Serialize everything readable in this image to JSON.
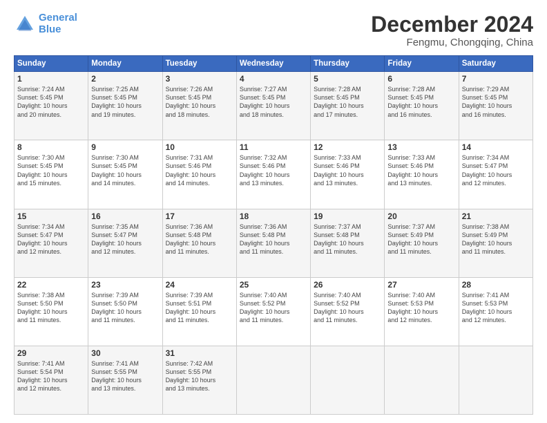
{
  "logo": {
    "line1": "General",
    "line2": "Blue"
  },
  "header": {
    "month": "December 2024",
    "location": "Fengmu, Chongqing, China"
  },
  "days_of_week": [
    "Sunday",
    "Monday",
    "Tuesday",
    "Wednesday",
    "Thursday",
    "Friday",
    "Saturday"
  ],
  "weeks": [
    [
      {
        "day": "1",
        "content": "Sunrise: 7:24 AM\nSunset: 5:45 PM\nDaylight: 10 hours\nand 20 minutes."
      },
      {
        "day": "2",
        "content": "Sunrise: 7:25 AM\nSunset: 5:45 PM\nDaylight: 10 hours\nand 19 minutes."
      },
      {
        "day": "3",
        "content": "Sunrise: 7:26 AM\nSunset: 5:45 PM\nDaylight: 10 hours\nand 18 minutes."
      },
      {
        "day": "4",
        "content": "Sunrise: 7:27 AM\nSunset: 5:45 PM\nDaylight: 10 hours\nand 18 minutes."
      },
      {
        "day": "5",
        "content": "Sunrise: 7:28 AM\nSunset: 5:45 PM\nDaylight: 10 hours\nand 17 minutes."
      },
      {
        "day": "6",
        "content": "Sunrise: 7:28 AM\nSunset: 5:45 PM\nDaylight: 10 hours\nand 16 minutes."
      },
      {
        "day": "7",
        "content": "Sunrise: 7:29 AM\nSunset: 5:45 PM\nDaylight: 10 hours\nand 16 minutes."
      }
    ],
    [
      {
        "day": "8",
        "content": "Sunrise: 7:30 AM\nSunset: 5:45 PM\nDaylight: 10 hours\nand 15 minutes."
      },
      {
        "day": "9",
        "content": "Sunrise: 7:30 AM\nSunset: 5:45 PM\nDaylight: 10 hours\nand 14 minutes."
      },
      {
        "day": "10",
        "content": "Sunrise: 7:31 AM\nSunset: 5:46 PM\nDaylight: 10 hours\nand 14 minutes."
      },
      {
        "day": "11",
        "content": "Sunrise: 7:32 AM\nSunset: 5:46 PM\nDaylight: 10 hours\nand 13 minutes."
      },
      {
        "day": "12",
        "content": "Sunrise: 7:33 AM\nSunset: 5:46 PM\nDaylight: 10 hours\nand 13 minutes."
      },
      {
        "day": "13",
        "content": "Sunrise: 7:33 AM\nSunset: 5:46 PM\nDaylight: 10 hours\nand 13 minutes."
      },
      {
        "day": "14",
        "content": "Sunrise: 7:34 AM\nSunset: 5:47 PM\nDaylight: 10 hours\nand 12 minutes."
      }
    ],
    [
      {
        "day": "15",
        "content": "Sunrise: 7:34 AM\nSunset: 5:47 PM\nDaylight: 10 hours\nand 12 minutes."
      },
      {
        "day": "16",
        "content": "Sunrise: 7:35 AM\nSunset: 5:47 PM\nDaylight: 10 hours\nand 12 minutes."
      },
      {
        "day": "17",
        "content": "Sunrise: 7:36 AM\nSunset: 5:48 PM\nDaylight: 10 hours\nand 11 minutes."
      },
      {
        "day": "18",
        "content": "Sunrise: 7:36 AM\nSunset: 5:48 PM\nDaylight: 10 hours\nand 11 minutes."
      },
      {
        "day": "19",
        "content": "Sunrise: 7:37 AM\nSunset: 5:48 PM\nDaylight: 10 hours\nand 11 minutes."
      },
      {
        "day": "20",
        "content": "Sunrise: 7:37 AM\nSunset: 5:49 PM\nDaylight: 10 hours\nand 11 minutes."
      },
      {
        "day": "21",
        "content": "Sunrise: 7:38 AM\nSunset: 5:49 PM\nDaylight: 10 hours\nand 11 minutes."
      }
    ],
    [
      {
        "day": "22",
        "content": "Sunrise: 7:38 AM\nSunset: 5:50 PM\nDaylight: 10 hours\nand 11 minutes."
      },
      {
        "day": "23",
        "content": "Sunrise: 7:39 AM\nSunset: 5:50 PM\nDaylight: 10 hours\nand 11 minutes."
      },
      {
        "day": "24",
        "content": "Sunrise: 7:39 AM\nSunset: 5:51 PM\nDaylight: 10 hours\nand 11 minutes."
      },
      {
        "day": "25",
        "content": "Sunrise: 7:40 AM\nSunset: 5:52 PM\nDaylight: 10 hours\nand 11 minutes."
      },
      {
        "day": "26",
        "content": "Sunrise: 7:40 AM\nSunset: 5:52 PM\nDaylight: 10 hours\nand 11 minutes."
      },
      {
        "day": "27",
        "content": "Sunrise: 7:40 AM\nSunset: 5:53 PM\nDaylight: 10 hours\nand 12 minutes."
      },
      {
        "day": "28",
        "content": "Sunrise: 7:41 AM\nSunset: 5:53 PM\nDaylight: 10 hours\nand 12 minutes."
      }
    ],
    [
      {
        "day": "29",
        "content": "Sunrise: 7:41 AM\nSunset: 5:54 PM\nDaylight: 10 hours\nand 12 minutes."
      },
      {
        "day": "30",
        "content": "Sunrise: 7:41 AM\nSunset: 5:55 PM\nDaylight: 10 hours\nand 13 minutes."
      },
      {
        "day": "31",
        "content": "Sunrise: 7:42 AM\nSunset: 5:55 PM\nDaylight: 10 hours\nand 13 minutes."
      },
      {
        "day": "",
        "content": ""
      },
      {
        "day": "",
        "content": ""
      },
      {
        "day": "",
        "content": ""
      },
      {
        "day": "",
        "content": ""
      }
    ]
  ]
}
